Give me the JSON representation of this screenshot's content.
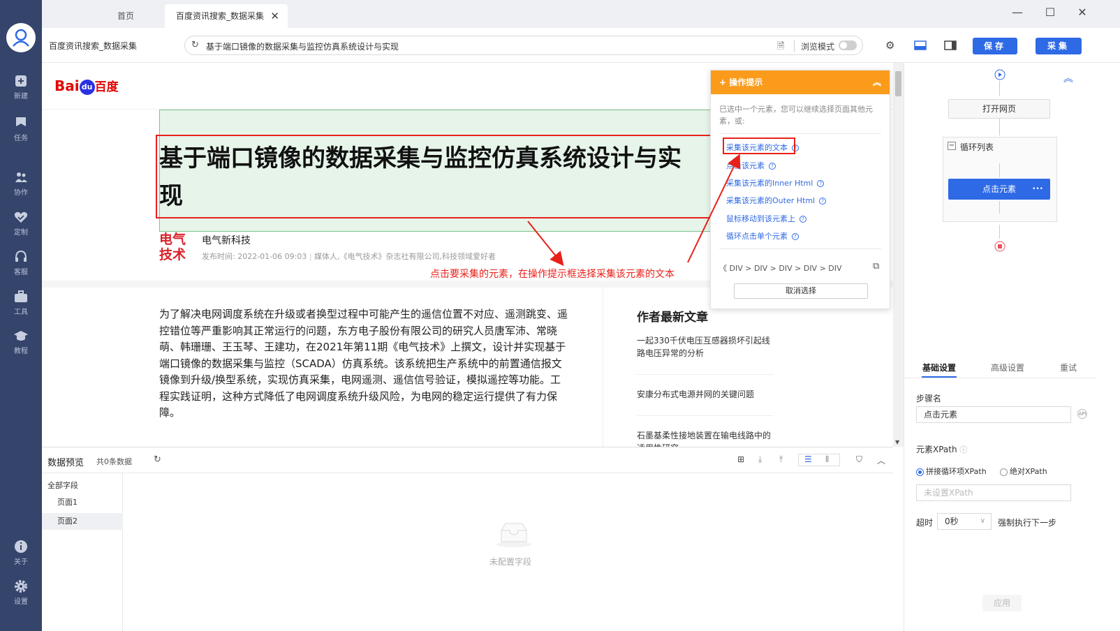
{
  "sidebar": {
    "items": [
      {
        "label": "新建",
        "icon": "plus-icon"
      },
      {
        "label": "任务",
        "icon": "flag-icon"
      },
      {
        "label": "协作",
        "icon": "users-icon"
      },
      {
        "label": "定制",
        "icon": "heart-check-icon"
      },
      {
        "label": "客服",
        "icon": "headset-icon"
      },
      {
        "label": "工具",
        "icon": "toolbox-icon"
      },
      {
        "label": "教程",
        "icon": "graduation-cap-icon"
      },
      {
        "label": "关于",
        "icon": "info-icon"
      },
      {
        "label": "设置",
        "icon": "gear-icon"
      }
    ]
  },
  "tabs": {
    "home": "首页",
    "active": "百度资讯搜索_数据采集",
    "close": "✕"
  },
  "window_controls": {
    "minimize": "—",
    "maximize": "☐",
    "close": "✕"
  },
  "toolbar": {
    "page_name": "百度资讯搜索_数据采集",
    "url": "基于端口镜像的数据采集与监控仿真系统设计与实现",
    "browse_mode_label": "浏览模式",
    "save_label": "保存",
    "collect_label": "采集"
  },
  "webpage": {
    "logo_bai": "Bai",
    "logo_du": "du",
    "logo_cn": "百度",
    "title_line1": "基于端口镜像的数据采集与监控仿真系统设计与实",
    "title_line2": "现",
    "author_logo_top": "电气",
    "author_logo_bottom": "技术",
    "author_name": "电气新科技",
    "pubtime": "发布时间: 2022-01-06 09:03",
    "author_desc": "媒体人,《电气技术》杂志社有限公司,科技领域爱好者",
    "annotation": "点击要采集的元素，在操作提示框选择采集该元素的文本",
    "body": "为了解决电网调度系统在升级或者换型过程中可能产生的遥信位置不对应、遥测跳变、遥控错位等严重影响其正常运行的问题，东方电子股份有限公司的研究人员唐军沛、常晓萌、韩珊珊、王玉琴、王建功，在2021年第11期《电气技术》上撰文，设计并实现基于端口镜像的数据采集与监控（SCADA）仿真系统。该系统把生产系统中的前置通信报文镜像到升级/换型系统，实现仿真采集，电网遥测、遥信信号验证，模拟遥控等功能。工程实践证明，这种方式降低了电网调度系统升级风险，为电网的稳定运行提供了有力保障。",
    "side_heading": "作者最新文章",
    "side_articles": [
      "一起330千伏电压互感器损坏引起线路电压异常的分析",
      "安康分布式电源并网的关键问题",
      "石墨基柔性接地装置在输电线路中的适用性研究"
    ]
  },
  "tips": {
    "header": "操作提示",
    "collapse": "︽",
    "desc": "已选中一个元素，您可以继续选择页面其他元素，或:",
    "actions": [
      "采集该元素的文本",
      "点击该元素",
      "采集该元素的Inner Html",
      "采集该元素的Outer Html",
      "鼠标移动到该元素上",
      "循环点击单个元素"
    ],
    "breadcrumb": "《  DIV  >  DIV  >  DIV  >  DIV  >  DIV",
    "cancel": "取消选择"
  },
  "preview": {
    "title": "数据预览",
    "count": "共0条数据",
    "fields": [
      "全部字段",
      "页面1",
      "页面2"
    ],
    "empty": "未配置字段"
  },
  "flow": {
    "open_page": "打开网页",
    "loop_list": "循环列表",
    "click_element": "点击元素",
    "more": "•••"
  },
  "settings": {
    "tabs": [
      "基础设置",
      "高级设置",
      "重试"
    ],
    "step_name_label": "步骤名",
    "step_name_value": "点击元素",
    "xpath_label": "元素XPath",
    "radio_concat": "拼接循环项XPath",
    "radio_absolute": "绝对XPath",
    "xpath_placeholder": "未设置XPath",
    "timeout_label": "超时",
    "timeout_value": "0秒",
    "force_next": "强制执行下一步",
    "apply": "应用"
  },
  "colors": {
    "sidebar": "#35446b",
    "primary": "#2e6ae6",
    "tips_header": "#fa9b1b",
    "annotation_red": "#e8201a",
    "selection_green": "#e6f4e9"
  }
}
